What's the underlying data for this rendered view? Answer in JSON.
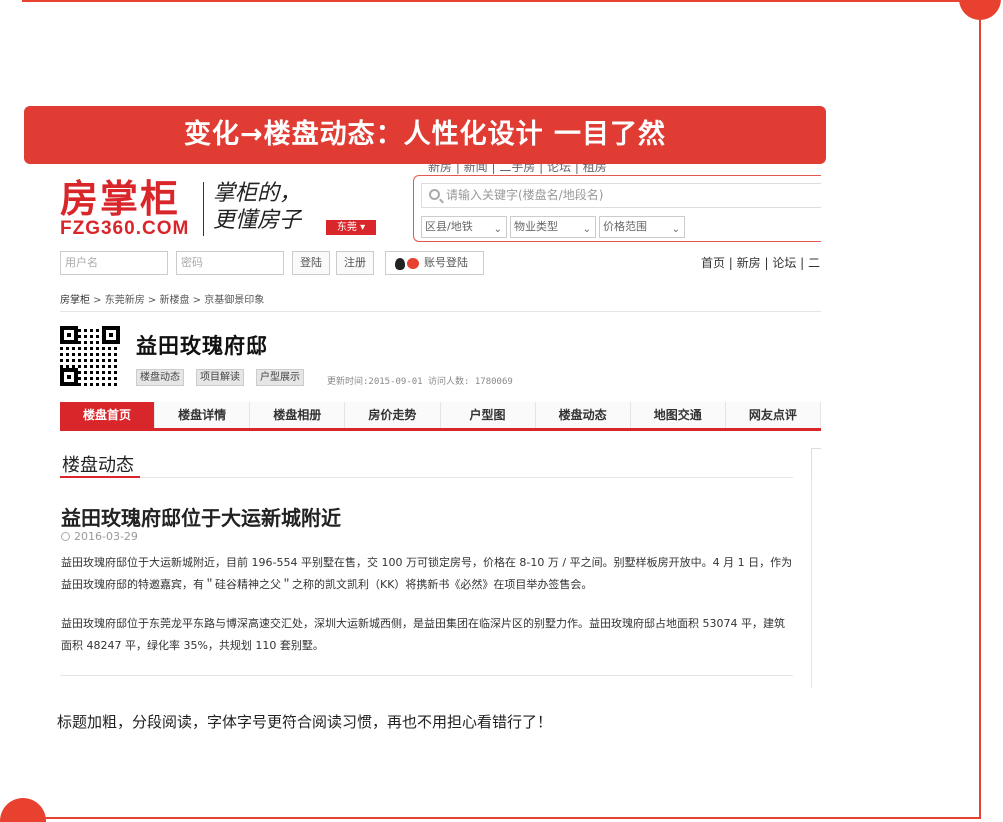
{
  "banner": {
    "text": "变化→楼盘动态：人性化设计 一目了然"
  },
  "site": {
    "top_links": "新房   |   新闻   |   二手房   |   论坛   |   租房",
    "logo_cn": "房掌柜",
    "logo_en": "FZG360.COM",
    "slogan_line1": "掌柜的，",
    "slogan_line2": "更懂房子",
    "city": "东莞 ▾"
  },
  "search": {
    "placeholder": "请输入关键字(楼盘名/地段名)",
    "filters": [
      "区县/地铁",
      "物业类型",
      "价格范围"
    ]
  },
  "login": {
    "username_placeholder": "用户名",
    "password_placeholder": "密码",
    "login_label": "登陆",
    "register_label": "注册",
    "social_label": "账号登陆",
    "nav_right": "首页 | 新房 | 论坛 | 二"
  },
  "breadcrumb": {
    "home": "房掌柜",
    "path": " > 东莞新房 > 新楼盘 > 京基御景印象"
  },
  "project": {
    "title": "益田玫瑰府邸",
    "tags": [
      "楼盘动态",
      "项目解读",
      "户型展示"
    ],
    "meta": "更新时间:2015-09-01  访问人数: 1780069"
  },
  "tabs": [
    "楼盘首页",
    "楼盘详情",
    "楼盘相册",
    "房价走势",
    "户型图",
    "楼盘动态",
    "地图交通",
    "网友点评"
  ],
  "section_title": "楼盘动态",
  "article": {
    "title": "益田玫瑰府邸位于大运新城附近",
    "date": "2016-03-29",
    "p1": "益田玫瑰府邸位于大运新城附近，目前 196-554 平别墅在售，交 100 万可锁定房号，价格在 8-10 万 / 平之间。别墅样板房开放中。4 月 1 日，作为益田玫瑰府邸的特邀嘉宾，有＂硅谷精神之父＂之称的凯文凯利（KK）将携新书《必然》在项目举办签售会。",
    "p2": "益田玫瑰府邸位于东莞龙平东路与博深高速交汇处，深圳大运新城西侧，是益田集团在临深片区的别墅力作。益田玫瑰府邸占地面积 53074 平，建筑面积 48247 平，绿化率 35%，共规划 110 套别墅。"
  },
  "caption": "标题加粗，分段阅读，字体字号更符合阅读习惯，再也不用担心看错行了！",
  "colors": {
    "accent": "#e13c34",
    "frame": "#e8412f",
    "brand": "#d9262b"
  }
}
